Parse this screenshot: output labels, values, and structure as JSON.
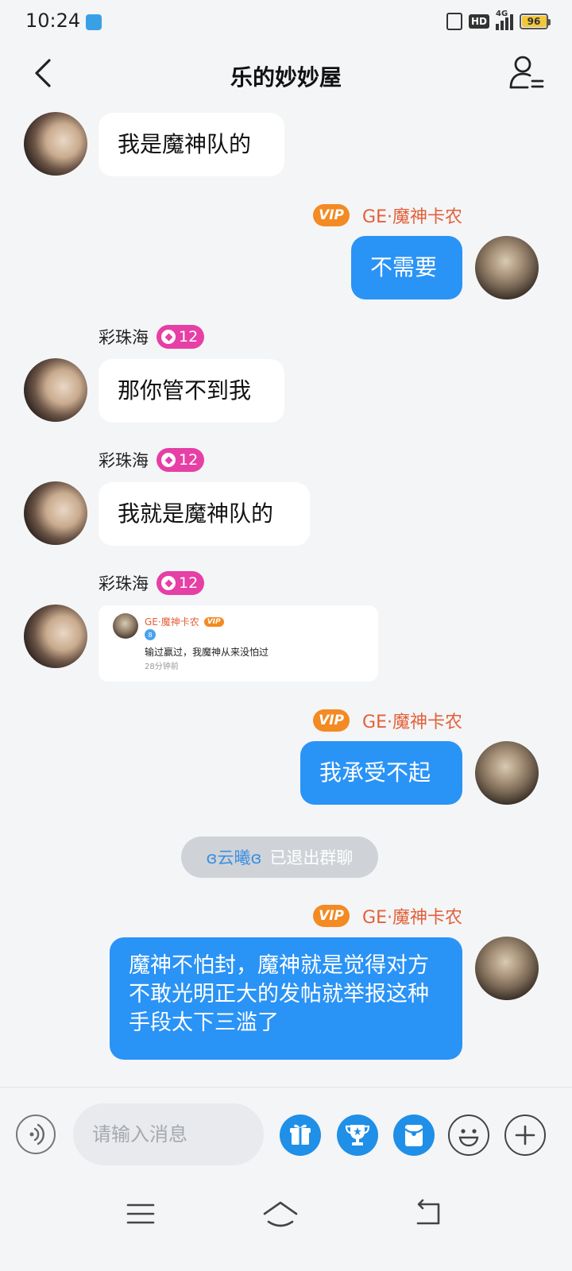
{
  "status": {
    "time": "10:24",
    "net": "4G",
    "hd": "HD",
    "battery": "96"
  },
  "header": {
    "title": "乐的妙妙屋"
  },
  "messages": {
    "m1": "我是魔神队的",
    "m2_sender": "GE·魔神卡农",
    "m2": "不需要",
    "m3_sender": "彩珠海",
    "m3_level": "12",
    "m3": "那你管不到我",
    "m4_sender": "彩珠海",
    "m4_level": "12",
    "m4": "我就是魔神队的",
    "m5_sender": "彩珠海",
    "m5_level": "12",
    "m6_sender": "GE·魔神卡农",
    "m6": "我承受不起",
    "m7_sender": "GE·魔神卡农",
    "m7": "魔神不怕封，魔神就是觉得对方不敢光明正大的发帖就举报这种手段太下三滥了"
  },
  "vip_label": "VIP",
  "card": {
    "name": "GE·魔神卡农",
    "vip": "VIP",
    "level": "8",
    "text": "输过赢过，我魔神从来没怕过",
    "time": "28分钟前"
  },
  "notice": {
    "name": "ɞ云曦ɞ",
    "text": "已退出群聊"
  },
  "input": {
    "placeholder": "请输入消息"
  }
}
